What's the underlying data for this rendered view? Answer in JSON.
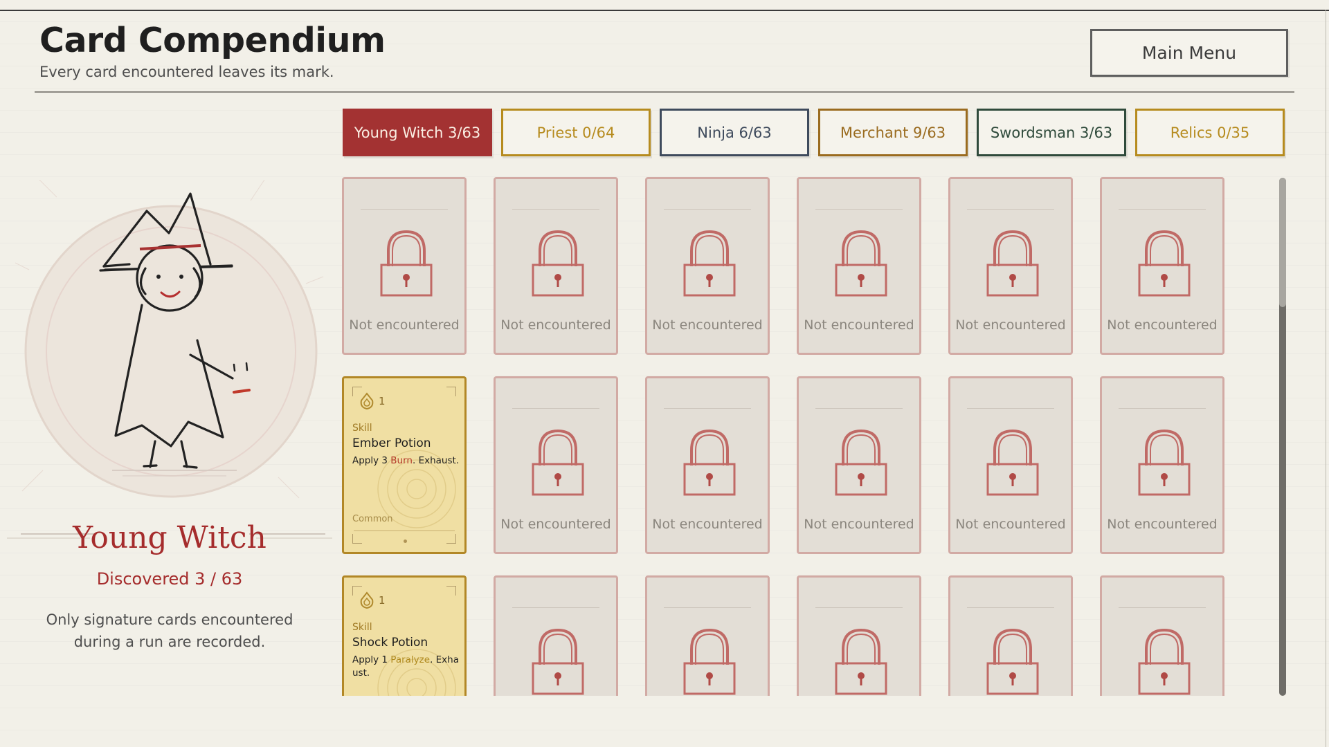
{
  "header": {
    "title": "Card Compendium",
    "subtitle": "Every card encountered leaves its mark.",
    "main_menu_label": "Main Menu"
  },
  "tabs": [
    {
      "label": "Young Witch  3/63",
      "color": "#a33232",
      "active": true
    },
    {
      "label": "Priest  0/64",
      "color": "#b68b1e"
    },
    {
      "label": "Ninja  6/63",
      "color": "#3e4a5c"
    },
    {
      "label": "Merchant  9/63",
      "color": "#9a6b1f"
    },
    {
      "label": "Swordsman  3/63",
      "color": "#2f4a3b"
    },
    {
      "label": "Relics  0/35",
      "color": "#b68b1e"
    }
  ],
  "character": {
    "name": "Young Witch",
    "discovered": "Discovered 3 / 63",
    "note": "Only signature cards encountered during a run are recorded."
  },
  "locked_label": "Not encountered",
  "cards": [
    {
      "locked": true
    },
    {
      "locked": true
    },
    {
      "locked": true
    },
    {
      "locked": true
    },
    {
      "locked": true
    },
    {
      "locked": true
    },
    {
      "locked": false,
      "cost": "1",
      "type": "Skill",
      "name": "Ember Potion",
      "desc_pre": "Apply 3 ",
      "keyword": "Burn",
      "keyword_class": "kw-burn",
      "desc_post": ". Exhaust.",
      "rarity": "Common"
    },
    {
      "locked": true
    },
    {
      "locked": true
    },
    {
      "locked": true
    },
    {
      "locked": true
    },
    {
      "locked": true
    },
    {
      "locked": false,
      "cost": "1",
      "type": "Skill",
      "name": "Shock Potion",
      "desc_pre": "Apply 1 ",
      "keyword": "Paralyze",
      "keyword_class": "kw-paralyze",
      "desc_post": ". Exhaust.",
      "rarity": ""
    },
    {
      "locked": true
    },
    {
      "locked": true
    },
    {
      "locked": true
    },
    {
      "locked": true
    },
    {
      "locked": true
    }
  ],
  "scroll": {
    "position": 0.0,
    "visible_fraction": 0.25
  },
  "colors": {
    "accent": "#a33232",
    "card_gold": "#f0dfa3",
    "lock": "#c06a66"
  },
  "icons": [
    "padlock-icon",
    "flame-cost-icon",
    "witch-portrait"
  ]
}
